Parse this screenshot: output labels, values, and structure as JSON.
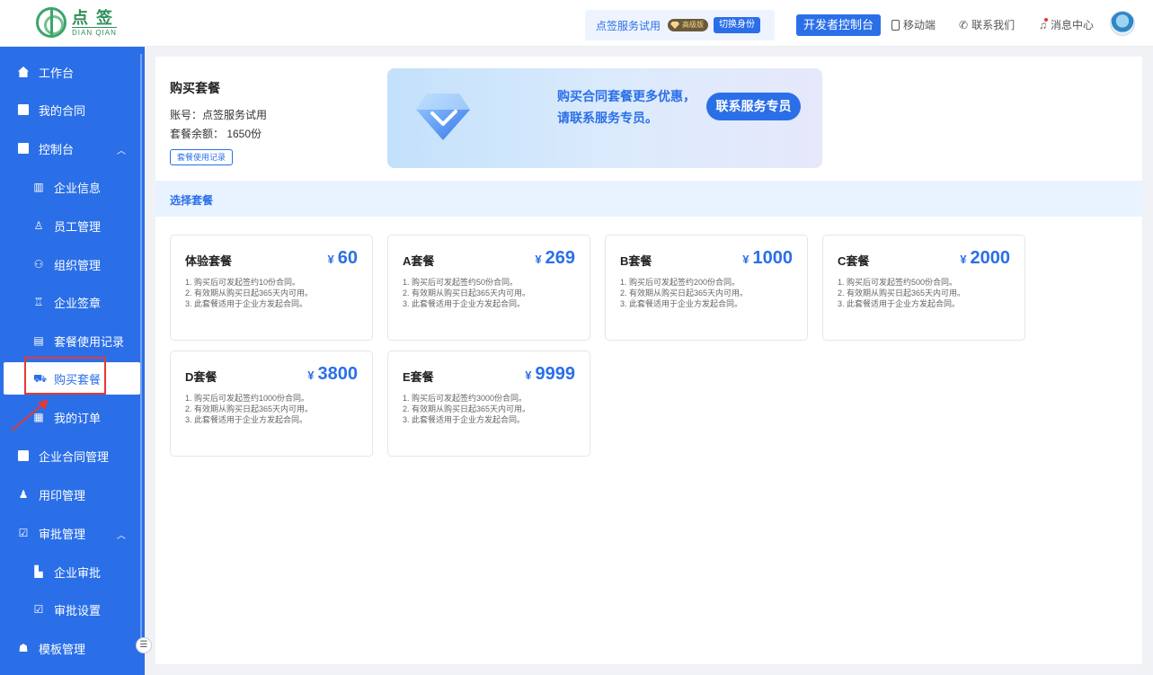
{
  "header": {
    "logo_cn": "点 签",
    "logo_en": "DIAN QIAN",
    "trial_name": "点签服务试用",
    "vip_label": "高级版",
    "switch_label": "切换身份",
    "dev_console": "开发者控制台",
    "mobile": "移动端",
    "contact": "联系我们",
    "messages": "消息中心"
  },
  "sidebar": {
    "items": [
      {
        "label": "工作台"
      },
      {
        "label": "我的合同"
      },
      {
        "label": "控制台"
      },
      {
        "label": "企业信息"
      },
      {
        "label": "员工管理"
      },
      {
        "label": "组织管理"
      },
      {
        "label": "企业签章"
      },
      {
        "label": "套餐使用记录"
      },
      {
        "label": "购买套餐"
      },
      {
        "label": "我的订单"
      },
      {
        "label": "企业合同管理"
      },
      {
        "label": "用印管理"
      },
      {
        "label": "审批管理"
      },
      {
        "label": "企业审批"
      },
      {
        "label": "审批设置"
      },
      {
        "label": "模板管理"
      }
    ]
  },
  "main": {
    "title": "购买套餐",
    "account": "账号：点签服务试用",
    "balance": "套餐余额： 1650份",
    "usage_button": "套餐使用记录",
    "banner_line1": "购买合同套餐更多优惠，",
    "banner_line2": "请联系服务专员。",
    "contact_button": "联系服务专员",
    "select_title": "选择套餐",
    "currency": "¥",
    "packages": [
      {
        "name": "体验套餐",
        "price": "60",
        "d1": "1. 购买后可发起签约10份合同。",
        "d2": "2. 有效期从购买日起365天内可用。",
        "d3": "3. 此套餐适用于企业方发起合同。"
      },
      {
        "name": "A套餐",
        "price": "269",
        "d1": "1. 购买后可发起签约50份合同。",
        "d2": "2. 有效期从购买日起365天内可用。",
        "d3": "3. 此套餐适用于企业方发起合同。"
      },
      {
        "name": "B套餐",
        "price": "1000",
        "d1": "1. 购买后可发起签约200份合同。",
        "d2": "2. 有效期从购买日起365天内可用。",
        "d3": "3. 此套餐适用于企业方发起合同。"
      },
      {
        "name": "C套餐",
        "price": "2000",
        "d1": "1. 购买后可发起签约500份合同。",
        "d2": "2. 有效期从购买日起365天内可用。",
        "d3": "3. 此套餐适用于企业方发起合同。"
      },
      {
        "name": "D套餐",
        "price": "3800",
        "d1": "1. 购买后可发起签约1000份合同。",
        "d2": "2. 有效期从购买日起365天内可用。",
        "d3": "3. 此套餐适用于企业方发起合同。"
      },
      {
        "name": "E套餐",
        "price": "9999",
        "d1": "1. 购买后可发起签约3000份合同。",
        "d2": "2. 有效期从购买日起365天内可用。",
        "d3": "3. 此套餐适用于企业方发起合同。"
      }
    ]
  },
  "colors": {
    "primary": "#2b6fe8",
    "highlight": "#e53935"
  },
  "icons": [
    "home-icon",
    "contract-icon",
    "console-icon",
    "building-icon",
    "user-icon",
    "org-icon",
    "seal-icon",
    "record-icon",
    "cart-icon",
    "order-icon",
    "folder-icon",
    "stamp-icon",
    "approval-icon",
    "chevron-up-icon",
    "bell-icon",
    "phone-icon",
    "headset-icon",
    "diamond-icon"
  ]
}
